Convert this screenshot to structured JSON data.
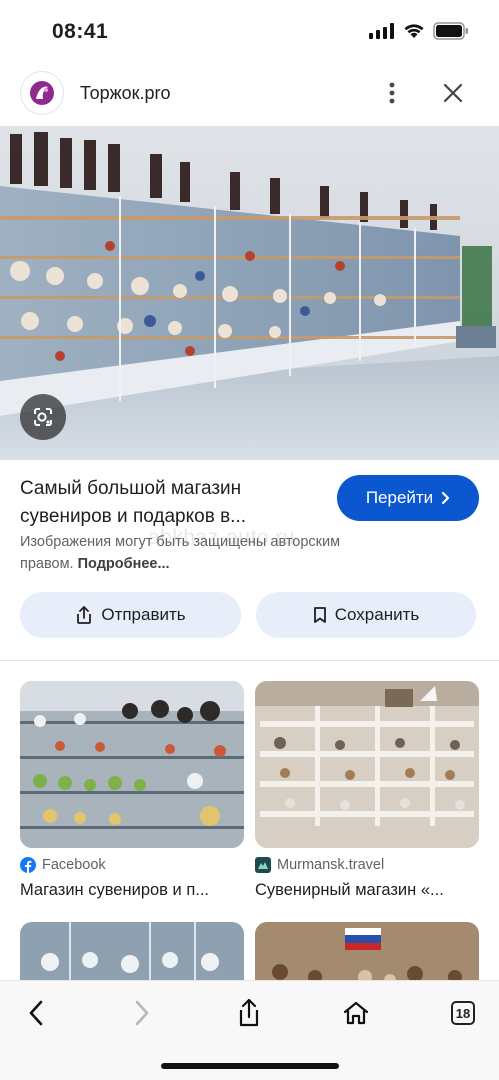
{
  "status_bar": {
    "time": "08:41"
  },
  "header": {
    "site_name": "Торжок.pro"
  },
  "hero": {
    "image_desc_icon": "lens-icon"
  },
  "result": {
    "title": "Самый большой магазин сувениров и подарков в...",
    "visit_label": "Перейти",
    "copyright_text": "Изображения могут быть защищены авторским правом.",
    "more_link": "Подробнее...",
    "watermark": "abkhaz-auto.ru",
    "share_label": "Отправить",
    "save_label": "Сохранить"
  },
  "related": [
    {
      "source": "Facebook",
      "title": "Магазин сувениров и п...",
      "source_icon": "facebook-icon"
    },
    {
      "source": "Murmansk.travel",
      "title": "Сувенирный магазин «...",
      "source_icon": "murmansk-travel-icon"
    }
  ],
  "toolbar": {
    "tabs_count": "18"
  },
  "colors": {
    "accent": "#0b57d0",
    "button_bg": "#e8eef9"
  }
}
